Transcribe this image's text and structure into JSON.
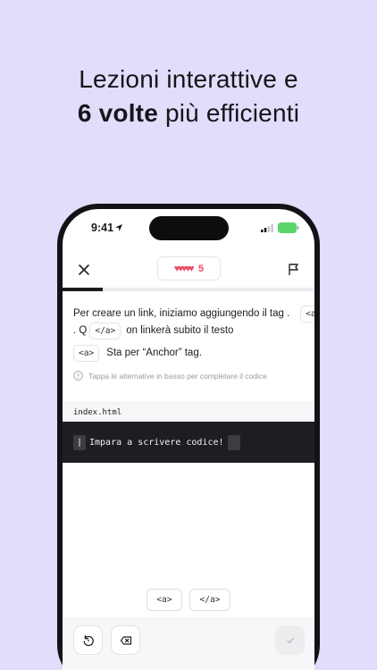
{
  "headline": {
    "line1": "Lezioni interattive e",
    "bold": "6 volte",
    "rest": " più efficienti"
  },
  "status": {
    "time": "9:41"
  },
  "topbar": {
    "hearts": "♥♥♥♥♥",
    "hearts_count": "5"
  },
  "progress": 0.16,
  "instructions": {
    "l1_text": "Per creare un link, iniziamo aggiungendo il tag .",
    "l1_chip": "<a>",
    "l2_prefix": ". Q",
    "l2_chip": "</a>",
    "l2_text": "on linkerà subito il testo",
    "l3_chip": "<a>",
    "l3_text": "Sta per “Anchor” tag.",
    "hint": "Tappa le alternative in basso per completare il codice"
  },
  "editor": {
    "filename": "index.html",
    "cursor": "|",
    "code": "Impara a scrivere codice!"
  },
  "options": [
    "<a>",
    "</a>"
  ]
}
